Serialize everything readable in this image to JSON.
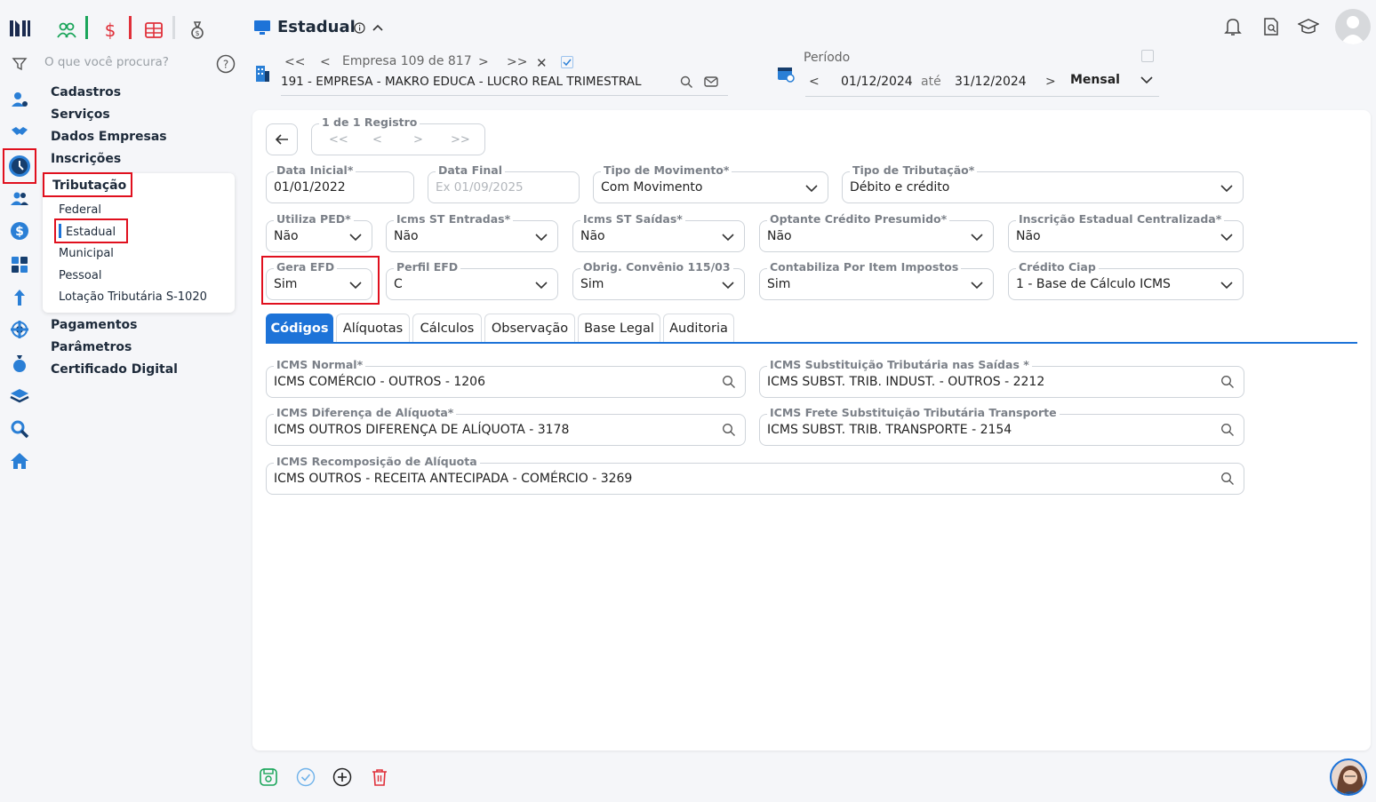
{
  "header": {
    "title": "Estadual",
    "search_placeholder": "O que você procura?"
  },
  "company": {
    "nav_label": "Empresa 109 de 817",
    "name": "191 - EMPRESA - MAKRO EDUCA - LUCRO REAL TRIMESTRAL"
  },
  "period": {
    "label": "Período",
    "start": "01/12/2024",
    "connector": "até",
    "end": "31/12/2024",
    "frequency": "Mensal"
  },
  "menu": {
    "cadastros": "Cadastros",
    "servicos": "Serviços",
    "dados_empresas": "Dados Empresas",
    "inscricoes": "Inscrições",
    "tributacao": "Tributação",
    "tributacao_items": [
      "Federal",
      "Estadual",
      "Municipal",
      "Pessoal",
      "Lotação Tributária S-1020"
    ],
    "pagamentos": "Pagamentos",
    "parametros": "Parâmetros",
    "certificado": "Certificado Digital"
  },
  "record_nav": {
    "label": "1 de 1 Registro"
  },
  "form": {
    "data_inicial": {
      "label": "Data Inicial*",
      "value": "01/01/2022"
    },
    "data_final": {
      "label": "Data Final",
      "placeholder": "Ex 01/09/2025"
    },
    "tipo_movimento": {
      "label": "Tipo de Movimento*",
      "value": "Com Movimento"
    },
    "tipo_tributacao": {
      "label": "Tipo de Tributação*",
      "value": "Débito e crédito"
    },
    "utiliza_ped": {
      "label": "Utiliza PED*",
      "value": "Não"
    },
    "icms_st_entradas": {
      "label": "Icms ST Entradas*",
      "value": "Não"
    },
    "icms_st_saidas": {
      "label": "Icms ST Saídas*",
      "value": "Não"
    },
    "optante_credito": {
      "label": "Optante Crédito Presumido*",
      "value": "Não"
    },
    "inscricao_centralizada": {
      "label": "Inscrição Estadual Centralizada*",
      "value": "Não"
    },
    "gera_efd": {
      "label": "Gera EFD",
      "value": "Sim"
    },
    "perfil_efd": {
      "label": "Perfil EFD",
      "value": "C"
    },
    "obrig_convenio": {
      "label": "Obrig. Convênio 115/03",
      "value": "Sim"
    },
    "contabiliza": {
      "label": "Contabiliza Por Item Impostos",
      "value": "Sim"
    },
    "credito_ciap": {
      "label": "Crédito Ciap",
      "value": "1 - Base de Cálculo ICMS"
    }
  },
  "tabs": [
    "Códigos",
    "Alíquotas",
    "Cálculos",
    "Observação",
    "Base Legal",
    "Auditoria"
  ],
  "codigos": {
    "icms_normal": {
      "label": "ICMS Normal*",
      "value": "ICMS COMÉRCIO - OUTROS - 1206"
    },
    "icms_subst_saidas": {
      "label": "ICMS Substituição Tributária nas Saídas *",
      "value": "ICMS SUBST. TRIB. INDUST. - OUTROS - 2212"
    },
    "icms_dif_aliquota": {
      "label": "ICMS Diferença de Alíquota*",
      "value": "ICMS OUTROS DIFERENÇA DE ALÍQUOTA - 3178"
    },
    "icms_frete": {
      "label": "ICMS Frete Substituição Tributária Transporte",
      "value": "ICMS SUBST. TRIB. TRANSPORTE - 2154"
    },
    "icms_recomposicao": {
      "label": "ICMS Recomposição de Alíquota",
      "value": "ICMS OUTROS - RECEITA ANTECIPADA - COMÉRCIO - 3269"
    }
  },
  "colors": {
    "accent": "#1d73d8",
    "highlight": "#e0101e",
    "menu_text": "#1d2a3a"
  }
}
